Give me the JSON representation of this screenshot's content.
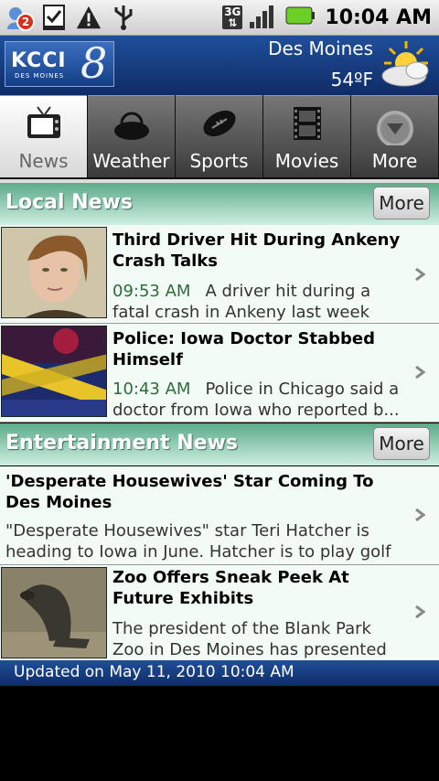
{
  "status_bar": {
    "notification_count": "2",
    "network_type": "3G",
    "time": "10:04 AM"
  },
  "header": {
    "logo_text": "KCCI",
    "logo_subtext": "DES MOINES",
    "logo_number": "8",
    "city": "Des Moines",
    "temperature": "54ºF",
    "weather_icon": "partly-sunny-icon"
  },
  "tabs": [
    {
      "label": "News",
      "icon": "tv-icon",
      "active": true
    },
    {
      "label": "Weather",
      "icon": "weather-cloud-icon",
      "active": false
    },
    {
      "label": "Sports",
      "icon": "football-icon",
      "active": false
    },
    {
      "label": "Movies",
      "icon": "film-icon",
      "active": false
    },
    {
      "label": "More",
      "icon": "chevron-down-circle-icon",
      "active": false
    }
  ],
  "sections": [
    {
      "title": "Local News",
      "more_label": "More",
      "items": [
        {
          "title": "Third Driver Hit During Ankeny Crash Talks",
          "time": "09:53 AM",
          "snippet_line1": "A driver hit during a",
          "snippet_line2": "fatal crash in Ankeny last week sp..."
        },
        {
          "title": "Police: Iowa Doctor Stabbed Himself",
          "time": "10:43 AM",
          "snippet_line1": "Police in Chicago said a",
          "snippet_line2": "doctor from Iowa who reported b..."
        }
      ]
    },
    {
      "title": "Entertainment News",
      "more_label": "More",
      "items": [
        {
          "title": "'Desperate Housewives' Star Coming To Des Moines",
          "snippet_line1": "\"Desperate Housewives\" star Teri Hatcher is",
          "snippet_line2": "heading to Iowa in June. Hatcher is to play golf ..."
        },
        {
          "title": "Zoo Offers Sneak Peek At Future Exhibits",
          "snippet_line1": "The president of the Blank Park",
          "snippet_line2": "Zoo in Des Moines has presented ..."
        }
      ]
    }
  ],
  "footer": {
    "updated_text": "Updated on May 11, 2010 10:04 AM"
  }
}
